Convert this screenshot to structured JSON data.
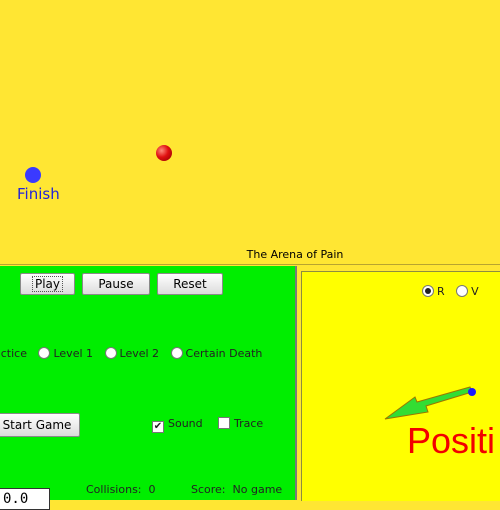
{
  "arena": {
    "title": "The Arena of Pain",
    "finish_label": "Finish"
  },
  "controls": {
    "play_label": "Play",
    "pause_label": "Pause",
    "reset_label": "Reset",
    "difficulty": {
      "options": [
        "actice",
        "Level 1",
        "Level 2",
        "Certain Death"
      ],
      "selected": null
    },
    "start_label": "Start Game",
    "sound_label": "Sound",
    "sound_checked": true,
    "trace_label": "Trace",
    "trace_checked": false,
    "collisions_label": "Collisions:",
    "collisions_value": "0",
    "score_label": "Score:",
    "score_value": "No game",
    "timer_value": "0.0"
  },
  "graph": {
    "mode_options": [
      "R",
      "V"
    ],
    "mode_selected": "R",
    "label": "Positi",
    "colors": {
      "arrow_fill": "#33dd33",
      "arrow_stroke": "#997700",
      "dot": "#1a1aff",
      "label": "#f20000"
    }
  }
}
